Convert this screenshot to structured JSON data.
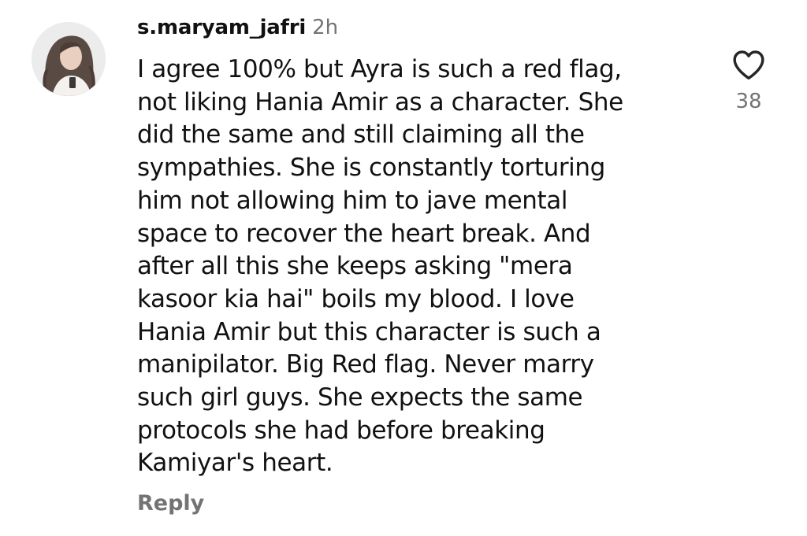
{
  "comment": {
    "username": "s.maryam_jafri",
    "time": "2h",
    "text": "I agree 100% but Ayra is such a red flag,\nnot liking Hania Amir as a character. She\ndid the same and still claiming all the\nsympathies. She is constantly torturing\nhim not allowing him to jave mental\nspace to recover the heart break. And\nafter all this she keeps asking \"mera\nkasoor kia hai\" boils my blood. I love\nHania Amir but this character is such a\nmanipilator. Big Red flag.  Never marry\nsuch girl guys. She expects the same\nprotocols she had before breaking\nKamiyar's heart.",
    "reply_label": "Reply",
    "like_count": "38",
    "avatar_icon": "profile-photo",
    "like_icon": "heart-outline-icon"
  },
  "colors": {
    "text": "#111111",
    "muted": "#737373",
    "background": "#ffffff"
  }
}
